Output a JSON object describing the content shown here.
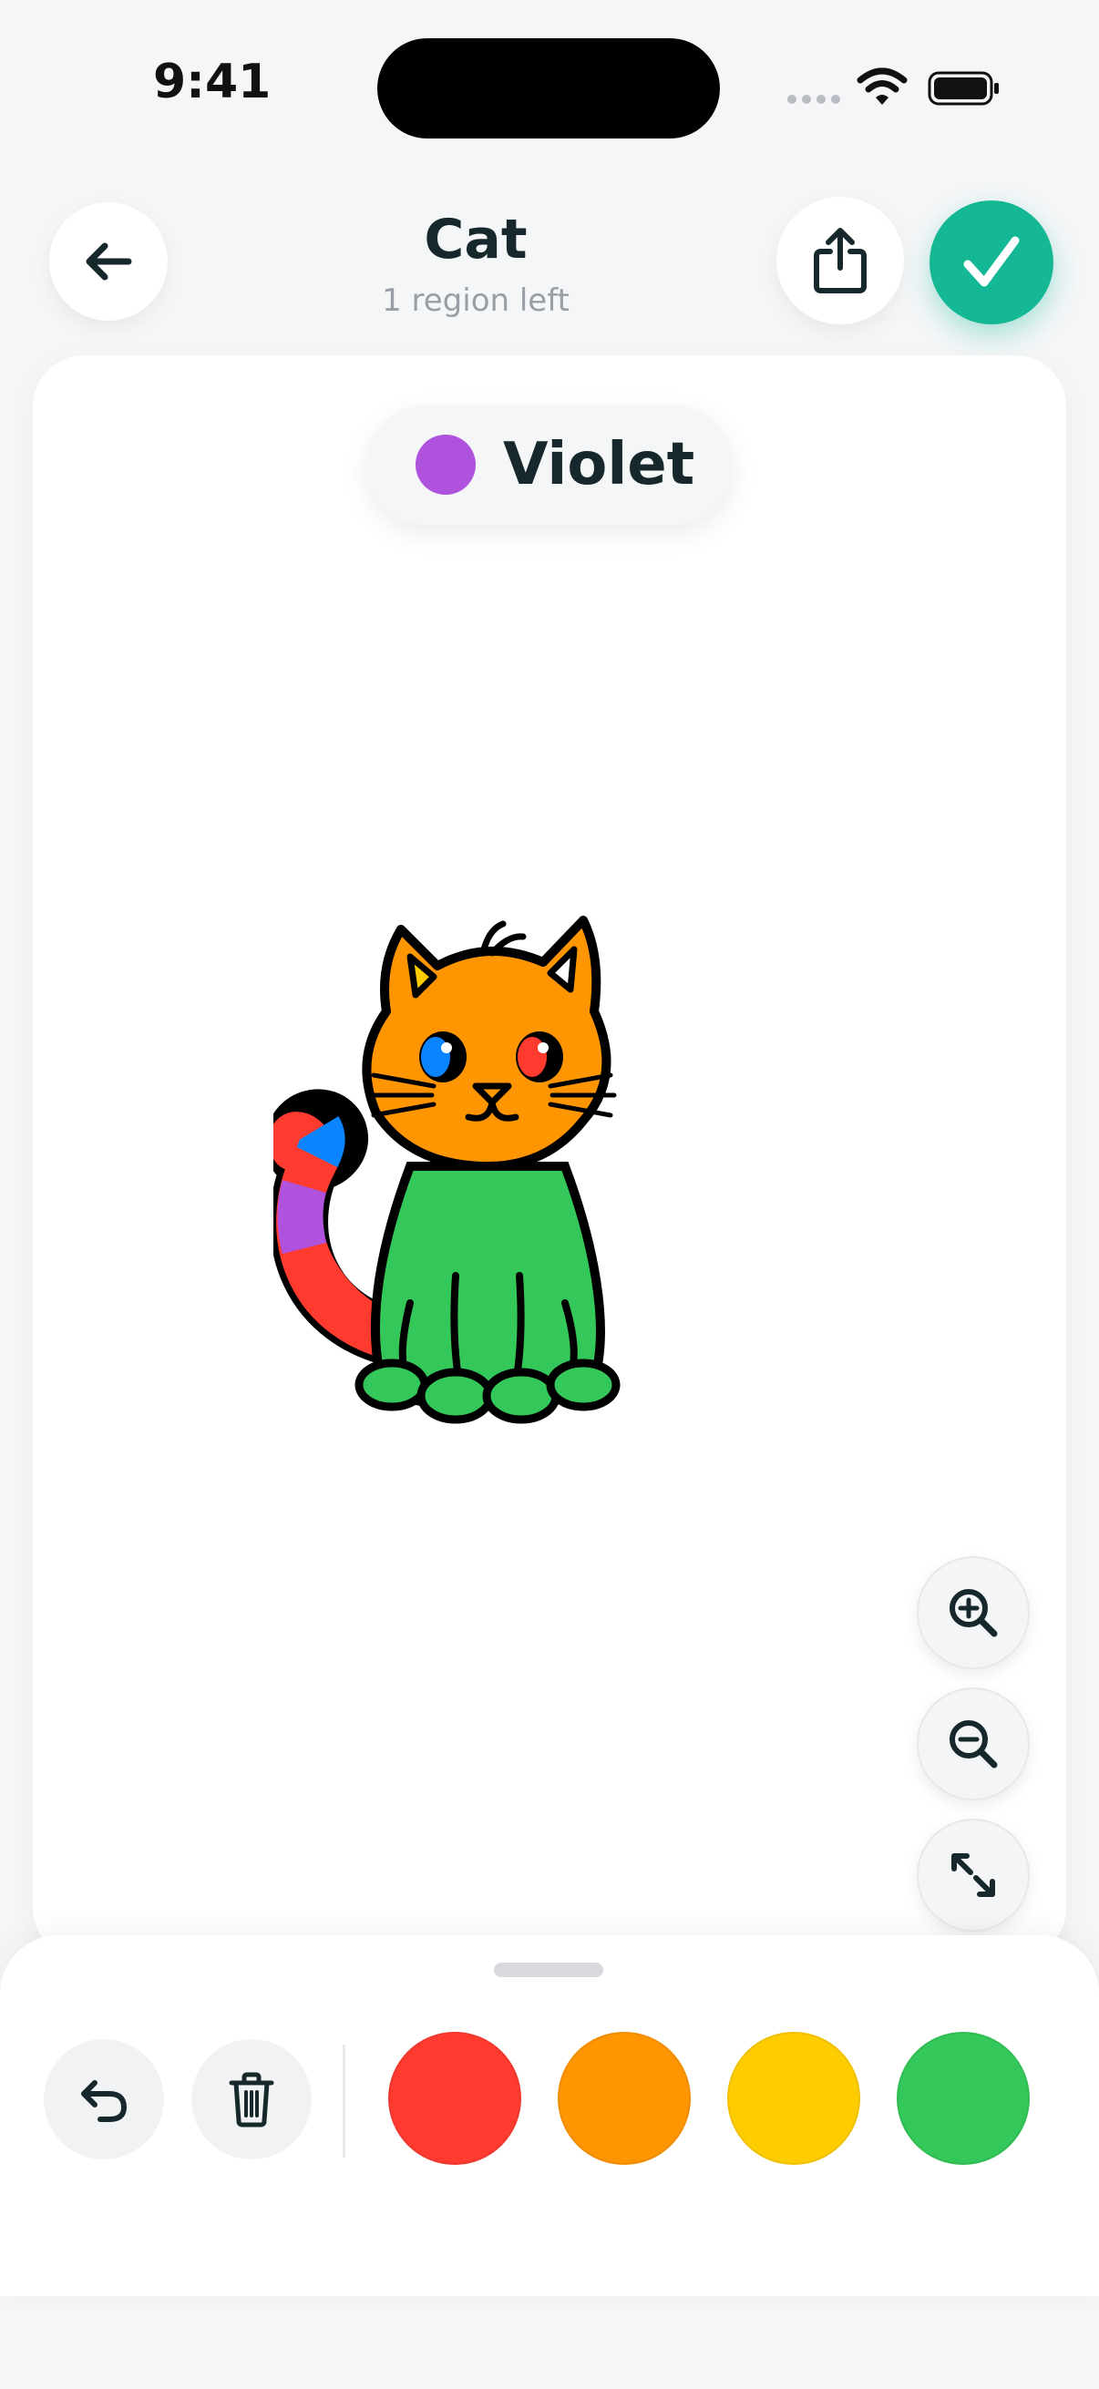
{
  "status_bar": {
    "time": "9:41"
  },
  "header": {
    "title": "Cat",
    "subtitle": "1 region left",
    "back_icon": "arrow-left-icon",
    "share_icon": "share-icon",
    "done_icon": "checkmark-icon",
    "done_color": "#14b894"
  },
  "current_color": {
    "name": "Violet",
    "hex": "#af52de"
  },
  "artwork": {
    "subject": "cat",
    "fills": {
      "head": "#ff9500",
      "body": "#34c759",
      "left_ear_inner": "#ffcc00",
      "right_ear_inner": "#ffffff",
      "left_eye": "#0a84ff",
      "right_eye": "#ff3b30",
      "tail_segments": [
        "#ff3b30",
        "#0a84ff",
        "#af52de",
        "#ff3b30",
        "#af52de"
      ]
    }
  },
  "zoom_controls": [
    "zoom-in-icon",
    "zoom-out-icon",
    "fit-screen-icon"
  ],
  "palette": {
    "tools": [
      "undo-icon",
      "trash-icon"
    ],
    "swatches": [
      {
        "name": "Red",
        "hex": "#ff3b30"
      },
      {
        "name": "Orange",
        "hex": "#ff9500"
      },
      {
        "name": "Yellow",
        "hex": "#ffcc00"
      },
      {
        "name": "Green",
        "hex": "#34c759"
      }
    ]
  }
}
